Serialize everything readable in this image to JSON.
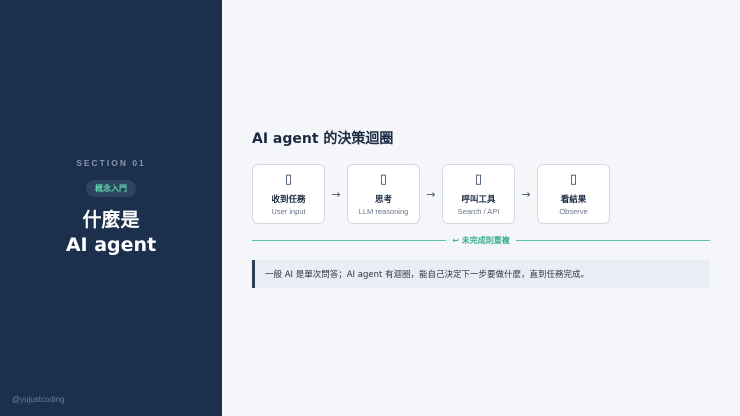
{
  "sidebar": {
    "section": "SECTION 01",
    "tag": "概念入門",
    "title_line1": "什麼是",
    "title_line2": "AI agent",
    "handle": "@yujustcoding"
  },
  "main": {
    "heading": "AI agent 的決策迴圈",
    "steps": [
      {
        "icon": "inbox-icon",
        "glyph": "▯",
        "title": "收到任務",
        "sub": "User input"
      },
      {
        "icon": "brain-icon",
        "glyph": "▯",
        "title": "思考",
        "sub": "LLM reasoning"
      },
      {
        "icon": "tool-icon",
        "glyph": "▯",
        "title": "呼叫工具",
        "sub": "Search / API"
      },
      {
        "icon": "eye-icon",
        "glyph": "▯",
        "title": "看結果",
        "sub": "Observe"
      }
    ],
    "arrow": "→",
    "loop_label": "↩ 未完成則重複",
    "note": "一般 AI 是單次問答；AI agent 有迴圈，能自己決定下一步要做什麼，直到任務完成。"
  },
  "colors": {
    "sidebar_bg": "#1c2f4c",
    "accent_green": "#5cc6a1",
    "page_bg": "#f4f6fa"
  }
}
